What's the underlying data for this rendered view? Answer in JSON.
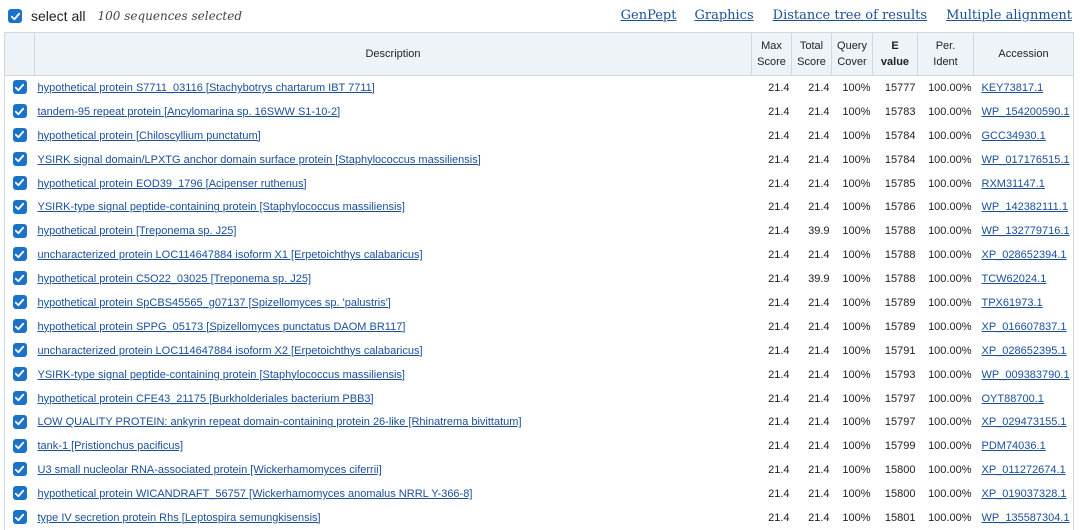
{
  "toolbar": {
    "select_all_label": "select all",
    "selected_count": "100 sequences selected",
    "links": [
      "GenPept",
      "Graphics",
      "Distance tree of results",
      "Multiple alignment"
    ]
  },
  "columns": {
    "description": "Description",
    "max_score": [
      "Max",
      "Score"
    ],
    "total_score": [
      "Total",
      "Score"
    ],
    "query_cover": [
      "Query",
      "Cover"
    ],
    "evalue": [
      "E",
      "value"
    ],
    "per_ident": [
      "Per.",
      "Ident"
    ],
    "accession": "Accession"
  },
  "rows": [
    {
      "description": "hypothetical protein S7711_03116 [Stachybotrys chartarum IBT 7711]",
      "max": "21.4",
      "total": "21.4",
      "cover": "100%",
      "evalue": "15777",
      "ident": "100.00%",
      "accession": "KEY73817.1"
    },
    {
      "description": "tandem-95 repeat protein [Ancylomarina sp. 16SWW S1-10-2]",
      "max": "21.4",
      "total": "21.4",
      "cover": "100%",
      "evalue": "15783",
      "ident": "100.00%",
      "accession": "WP_154200590.1"
    },
    {
      "description": "hypothetical protein [Chiloscyllium punctatum]",
      "max": "21.4",
      "total": "21.4",
      "cover": "100%",
      "evalue": "15784",
      "ident": "100.00%",
      "accession": "GCC34930.1"
    },
    {
      "description": "YSIRK signal domain/LPXTG anchor domain surface protein [Staphylococcus massiliensis]",
      "max": "21.4",
      "total": "21.4",
      "cover": "100%",
      "evalue": "15784",
      "ident": "100.00%",
      "accession": "WP_017176515.1"
    },
    {
      "description": "hypothetical protein EOD39_1796 [Acipenser ruthenus]",
      "max": "21.4",
      "total": "21.4",
      "cover": "100%",
      "evalue": "15785",
      "ident": "100.00%",
      "accession": "RXM31147.1"
    },
    {
      "description": "YSIRK-type signal peptide-containing protein [Staphylococcus massiliensis]",
      "max": "21.4",
      "total": "21.4",
      "cover": "100%",
      "evalue": "15786",
      "ident": "100.00%",
      "accession": "WP_142382111.1"
    },
    {
      "description": "hypothetical protein [Treponema sp. J25]",
      "max": "21.4",
      "total": "39.9",
      "cover": "100%",
      "evalue": "15788",
      "ident": "100.00%",
      "accession": "WP_132779716.1"
    },
    {
      "description": "uncharacterized protein LOC114647884 isoform X1 [Erpetoichthys calabaricus]",
      "max": "21.4",
      "total": "21.4",
      "cover": "100%",
      "evalue": "15788",
      "ident": "100.00%",
      "accession": "XP_028652394.1"
    },
    {
      "description": "hypothetical protein C5O22_03025 [Treponema sp. J25]",
      "max": "21.4",
      "total": "39.9",
      "cover": "100%",
      "evalue": "15788",
      "ident": "100.00%",
      "accession": "TCW62024.1"
    },
    {
      "description": "hypothetical protein SpCBS45565_g07137 [Spizellomyces sp. 'palustris']",
      "max": "21.4",
      "total": "21.4",
      "cover": "100%",
      "evalue": "15789",
      "ident": "100.00%",
      "accession": "TPX61973.1"
    },
    {
      "description": "hypothetical protein SPPG_05173 [Spizellomyces punctatus DAOM BR117]",
      "max": "21.4",
      "total": "21.4",
      "cover": "100%",
      "evalue": "15789",
      "ident": "100.00%",
      "accession": "XP_016607837.1"
    },
    {
      "description": "uncharacterized protein LOC114647884 isoform X2 [Erpetoichthys calabaricus]",
      "max": "21.4",
      "total": "21.4",
      "cover": "100%",
      "evalue": "15791",
      "ident": "100.00%",
      "accession": "XP_028652395.1"
    },
    {
      "description": "YSIRK-type signal peptide-containing protein [Staphylococcus massiliensis]",
      "max": "21.4",
      "total": "21.4",
      "cover": "100%",
      "evalue": "15793",
      "ident": "100.00%",
      "accession": "WP_009383790.1"
    },
    {
      "description": "hypothetical protein CFE43_21175 [Burkholderiales bacterium PBB3]",
      "max": "21.4",
      "total": "21.4",
      "cover": "100%",
      "evalue": "15797",
      "ident": "100.00%",
      "accession": "OYT88700.1"
    },
    {
      "description": "LOW QUALITY PROTEIN: ankyrin repeat domain-containing protein 26-like [Rhinatrema bivittatum]",
      "max": "21.4",
      "total": "21.4",
      "cover": "100%",
      "evalue": "15797",
      "ident": "100.00%",
      "accession": "XP_029473155.1"
    },
    {
      "description": "tank-1 [Pristionchus pacificus]",
      "max": "21.4",
      "total": "21.4",
      "cover": "100%",
      "evalue": "15799",
      "ident": "100.00%",
      "accession": "PDM74036.1"
    },
    {
      "description": "U3 small nucleolar RNA-associated protein [Wickerhamomyces ciferrii]",
      "max": "21.4",
      "total": "21.4",
      "cover": "100%",
      "evalue": "15800",
      "ident": "100.00%",
      "accession": "XP_011272674.1"
    },
    {
      "description": "hypothetical protein WICANDRAFT_56757 [Wickerhamomyces anomalus NRRL Y-366-8]",
      "max": "21.4",
      "total": "21.4",
      "cover": "100%",
      "evalue": "15800",
      "ident": "100.00%",
      "accession": "XP_019037328.1"
    },
    {
      "description": "type IV secretion protein Rhs [Leptospira semungkisensis]",
      "max": "21.4",
      "total": "21.4",
      "cover": "100%",
      "evalue": "15801",
      "ident": "100.00%",
      "accession": "WP_135587304.1"
    }
  ],
  "colors": {
    "accent": "#1a73c8",
    "link": "#1a4f9a",
    "header_bg": "#eef3f8",
    "border": "#cfd9e3"
  },
  "icons": {
    "checkbox": "checkbox-checked-icon"
  }
}
